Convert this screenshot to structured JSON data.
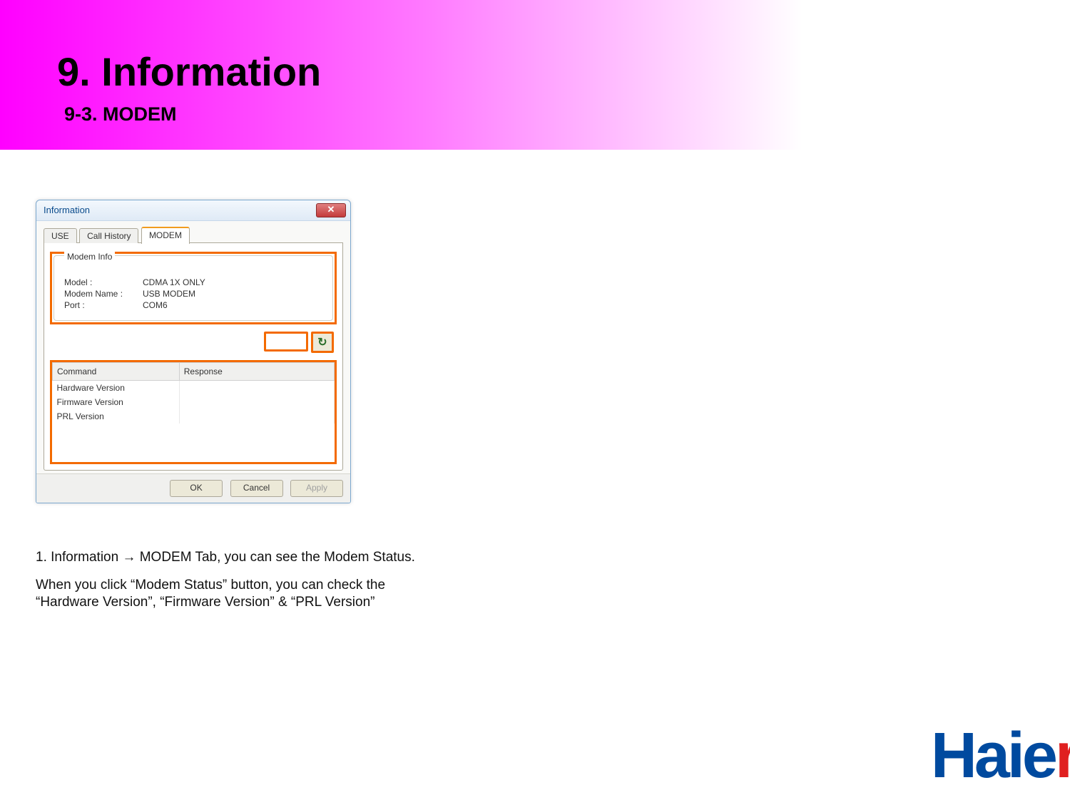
{
  "header": {
    "title": "9. Information",
    "subtitle": "9-3. MODEM"
  },
  "dialog": {
    "title": "Information",
    "close_glyph": "✕",
    "tabs": {
      "use": "USE",
      "call_history": "Call History",
      "modem": "MODEM"
    },
    "fieldset_legend": "Modem Info",
    "fields": {
      "model_label": "Model :",
      "model_value": "CDMA 1X ONLY",
      "name_label": "Modem Name :",
      "name_value": "USB MODEM",
      "port_label": "Port  :",
      "port_value": "COM6"
    },
    "refresh_icon_glyph": "↻",
    "table": {
      "col_command": "Command",
      "col_response": "Response",
      "rows": [
        "Hardware Version",
        "Firmware Version",
        "PRL Version"
      ]
    },
    "buttons": {
      "ok": "OK",
      "cancel": "Cancel",
      "apply": "Apply"
    }
  },
  "description": {
    "p1": "1. Information → MODEM Tab, you can see the Modem Status.",
    "p2": "When you click “Modem Status” button, you can check the “Hardware Version”, “Firmware Version” & “PRL Version”"
  },
  "logo": {
    "main": "Haie",
    "last": "r"
  }
}
